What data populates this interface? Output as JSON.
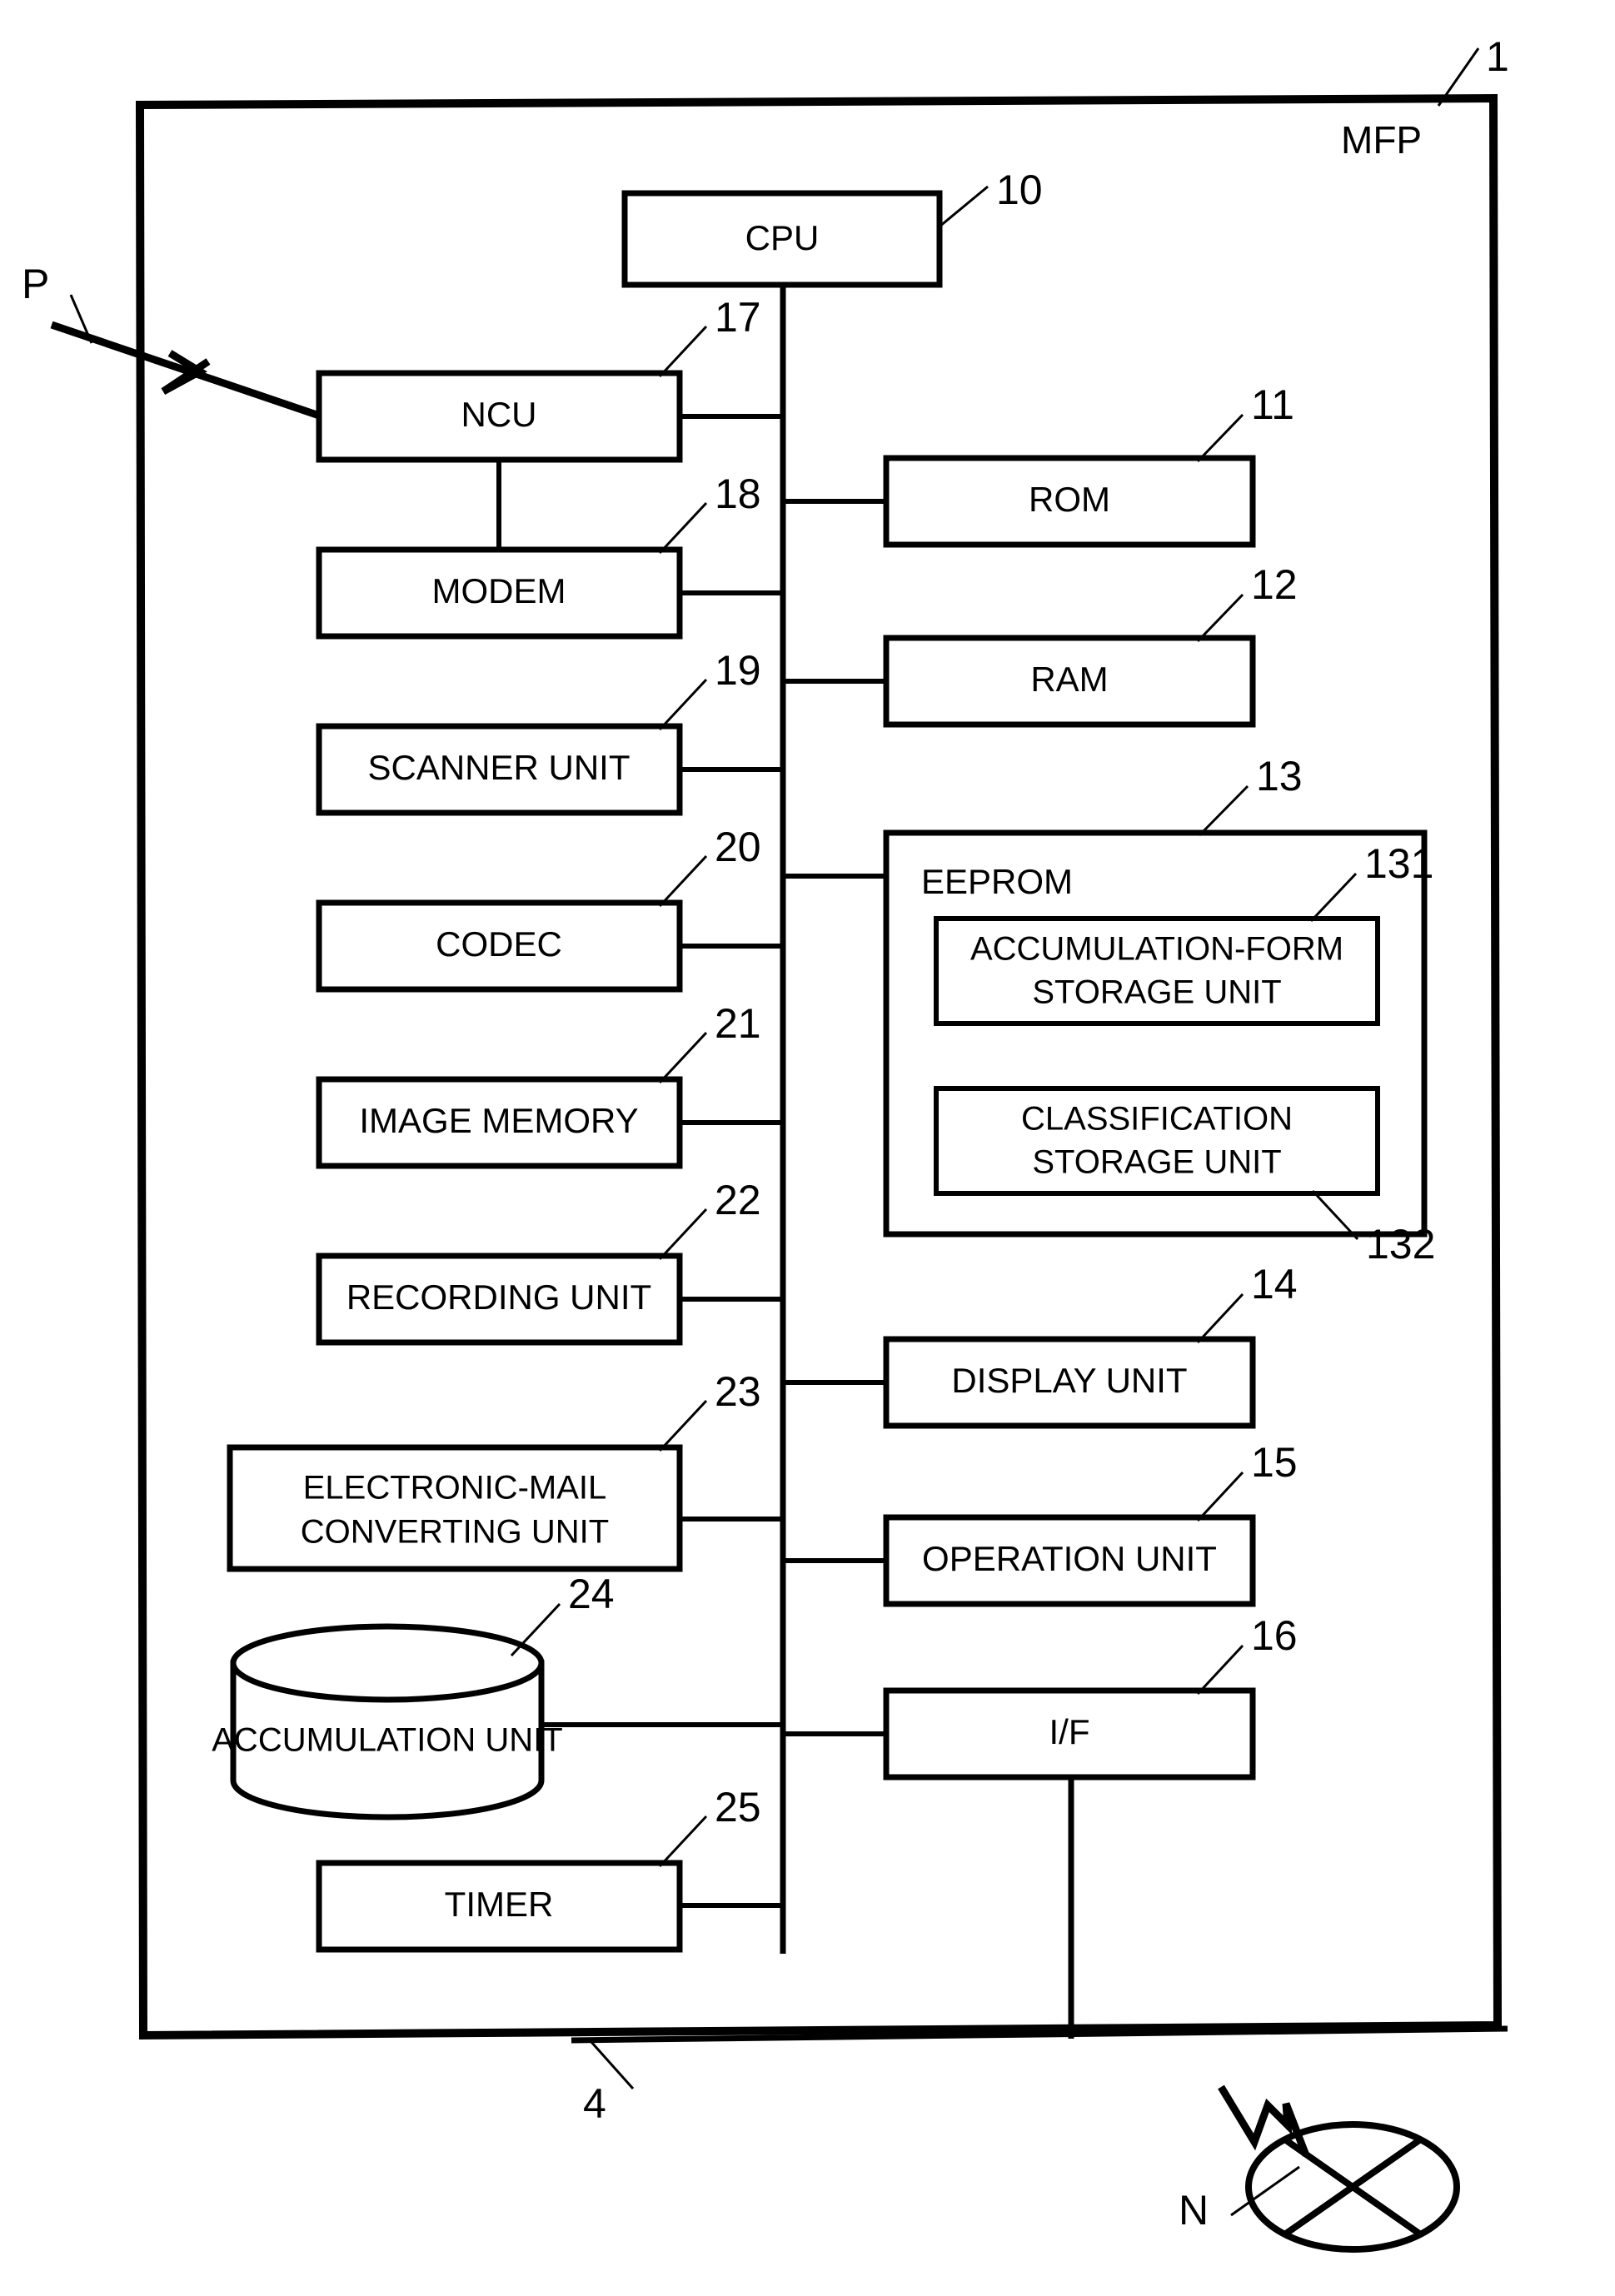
{
  "figure": {
    "device_label": "MFP",
    "device_ref": "1",
    "phone_line_label": "P",
    "network_line_ref": "4",
    "network_node_label": "N"
  },
  "cpu": {
    "label": "CPU",
    "ref": "10"
  },
  "left_column": [
    {
      "label": "NCU",
      "ref": "17",
      "lines": [
        "NCU"
      ]
    },
    {
      "label": "MODEM",
      "ref": "18",
      "lines": [
        "MODEM"
      ]
    },
    {
      "label": "SCANNER UNIT",
      "ref": "19",
      "lines": [
        "SCANNER UNIT"
      ]
    },
    {
      "label": "CODEC",
      "ref": "20",
      "lines": [
        "CODEC"
      ]
    },
    {
      "label": "IMAGE MEMORY",
      "ref": "21",
      "lines": [
        "IMAGE MEMORY"
      ]
    },
    {
      "label": "RECORDING UNIT",
      "ref": "22",
      "lines": [
        "RECORDING UNIT"
      ]
    },
    {
      "label": "ELECTRONIC-MAIL CONVERTING UNIT",
      "ref": "23",
      "lines": [
        "ELECTRONIC-MAIL",
        "CONVERTING UNIT"
      ]
    },
    {
      "label": "ACCUMULATION UNIT",
      "ref": "24",
      "lines": [
        "ACCUMULATION UNIT"
      ]
    },
    {
      "label": "TIMER",
      "ref": "25",
      "lines": [
        "TIMER"
      ]
    }
  ],
  "right_column": [
    {
      "label": "ROM",
      "ref": "11",
      "lines": [
        "ROM"
      ]
    },
    {
      "label": "RAM",
      "ref": "12",
      "lines": [
        "RAM"
      ]
    },
    {
      "label": "EEPROM",
      "ref": "13",
      "lines": [
        "EEPROM"
      ]
    },
    {
      "label": "DISPLAY UNIT",
      "ref": "14",
      "lines": [
        "DISPLAY UNIT"
      ]
    },
    {
      "label": "OPERATION UNIT",
      "ref": "15",
      "lines": [
        "OPERATION UNIT"
      ]
    },
    {
      "label": "I/F",
      "ref": "16",
      "lines": [
        "I/F"
      ]
    }
  ],
  "eeprom_children": [
    {
      "label": "ACCUMULATION-FORM STORAGE UNIT",
      "ref": "131",
      "lines": [
        "ACCUMULATION-FORM",
        "STORAGE UNIT"
      ]
    },
    {
      "label": "CLASSIFICATION STORAGE UNIT",
      "ref": "132",
      "lines": [
        "CLASSIFICATION",
        "STORAGE UNIT"
      ]
    }
  ],
  "colors": {
    "line": "#000000",
    "background": "#ffffff"
  }
}
